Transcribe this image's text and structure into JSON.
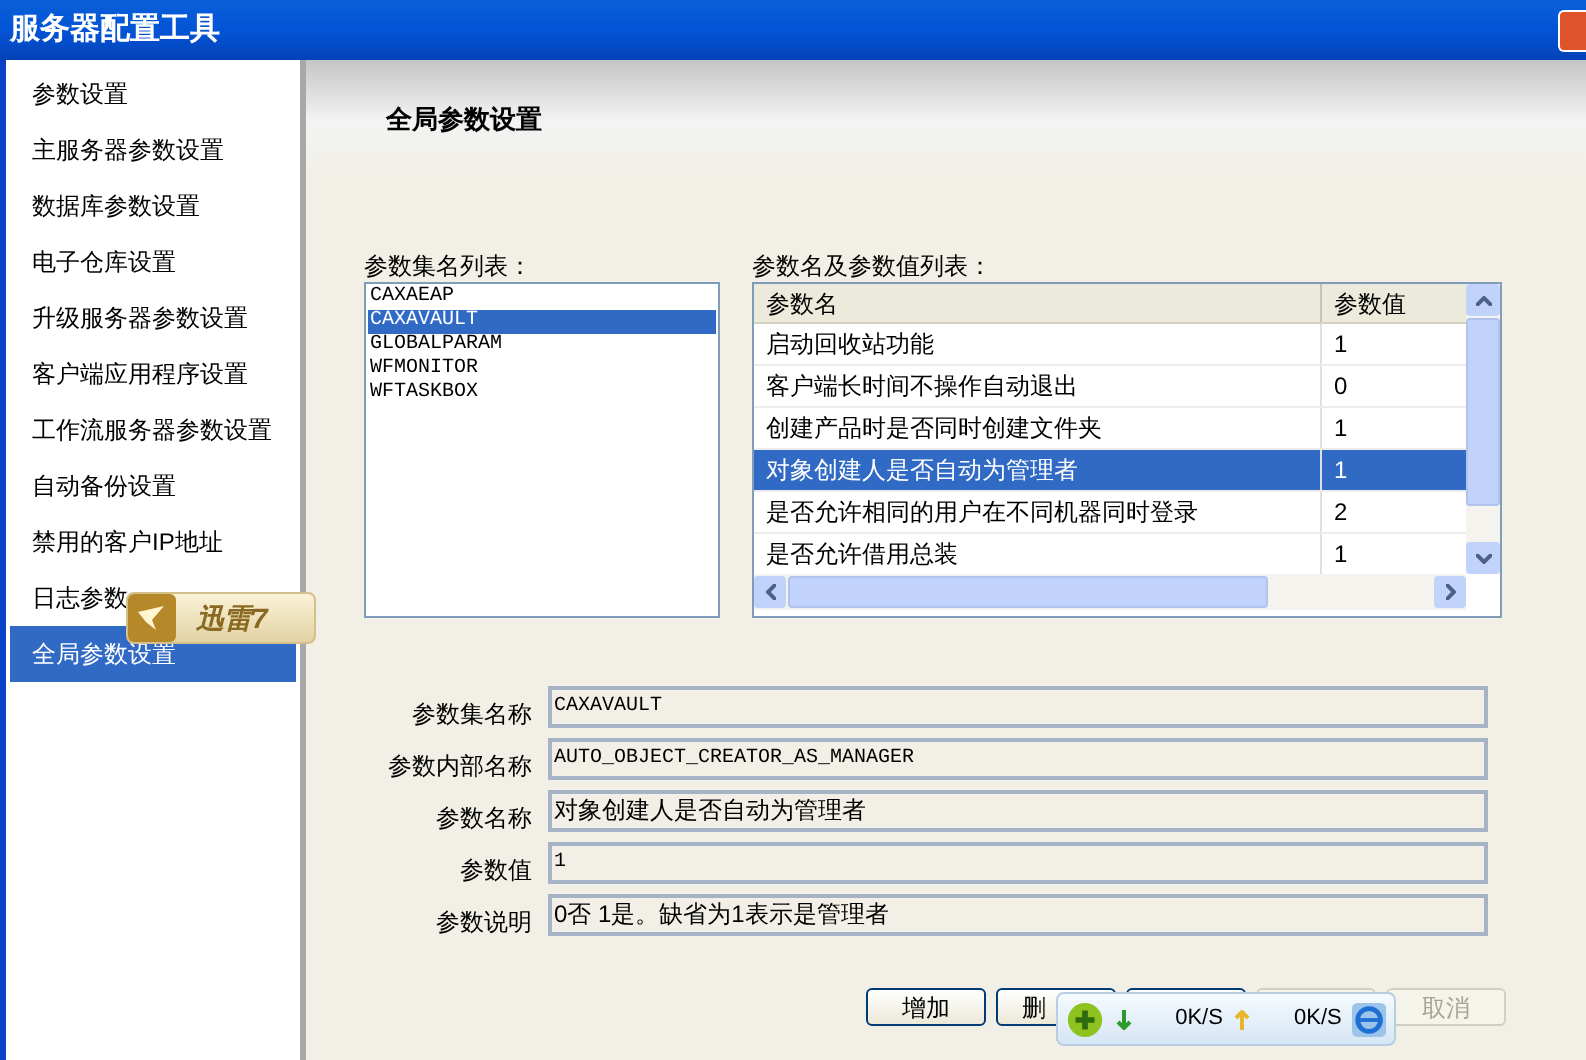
{
  "window": {
    "title": "服务器配置工具"
  },
  "sidebar": {
    "items": [
      {
        "label": "参数设置",
        "selected": false
      },
      {
        "label": "主服务器参数设置",
        "selected": false
      },
      {
        "label": "数据库参数设置",
        "selected": false
      },
      {
        "label": "电子仓库设置",
        "selected": false
      },
      {
        "label": "升级服务器参数设置",
        "selected": false
      },
      {
        "label": "客户端应用程序设置",
        "selected": false
      },
      {
        "label": "工作流服务器参数设置",
        "selected": false
      },
      {
        "label": "自动备份设置",
        "selected": false
      },
      {
        "label": "禁用的客户IP地址",
        "selected": false
      },
      {
        "label": "日志参数",
        "selected": false
      },
      {
        "label": "全局参数设置",
        "selected": true
      }
    ]
  },
  "header": {
    "title": "全局参数设置"
  },
  "set_list": {
    "label": "参数集名列表：",
    "items": [
      {
        "label": "CAXAEAP",
        "selected": false
      },
      {
        "label": "CAXAVAULT",
        "selected": true
      },
      {
        "label": "GLOBALPARAM",
        "selected": false
      },
      {
        "label": "WFMONITOR",
        "selected": false
      },
      {
        "label": "WFTASKBOX",
        "selected": false
      }
    ]
  },
  "param_table": {
    "label": "参数名及参数值列表：",
    "columns": [
      "参数名",
      "参数值"
    ],
    "rows": [
      {
        "cells": [
          "启动回收站功能",
          "1"
        ],
        "selected": false
      },
      {
        "cells": [
          "客户端长时间不操作自动退出",
          "0"
        ],
        "selected": false
      },
      {
        "cells": [
          "创建产品时是否同时创建文件夹",
          "1"
        ],
        "selected": false
      },
      {
        "cells": [
          "对象创建人是否自动为管理者",
          "1"
        ],
        "selected": true
      },
      {
        "cells": [
          "是否允许相同的用户在不同机器同时登录",
          "2"
        ],
        "selected": false
      },
      {
        "cells": [
          "是否允许借用总装",
          "1"
        ],
        "selected": false
      }
    ]
  },
  "fields": [
    {
      "label": "参数集名称",
      "value": "CAXAVAULT",
      "kind": "mono"
    },
    {
      "label": "参数内部名称",
      "value": "AUTO_OBJECT_CREATOR_AS_MANAGER",
      "kind": "mono"
    },
    {
      "label": "参数名称",
      "value": "对象创建人是否自动为管理者",
      "kind": "text"
    },
    {
      "label": "参数值",
      "value": "1",
      "kind": "mono"
    },
    {
      "label": "参数说明",
      "value": "0否 1是。缺省为1表示是管理者",
      "kind": "text"
    }
  ],
  "buttons": [
    {
      "label": "增加",
      "disabled": false
    },
    {
      "label": "删",
      "disabled": false
    },
    {
      "disabled": false
    },
    {
      "disabled": true
    },
    {
      "label": "取消",
      "disabled": true
    }
  ],
  "xunlei_badge": {
    "label": "迅雷7"
  },
  "speed_bar": {
    "download": "0K/S",
    "upload": "0K/S"
  }
}
